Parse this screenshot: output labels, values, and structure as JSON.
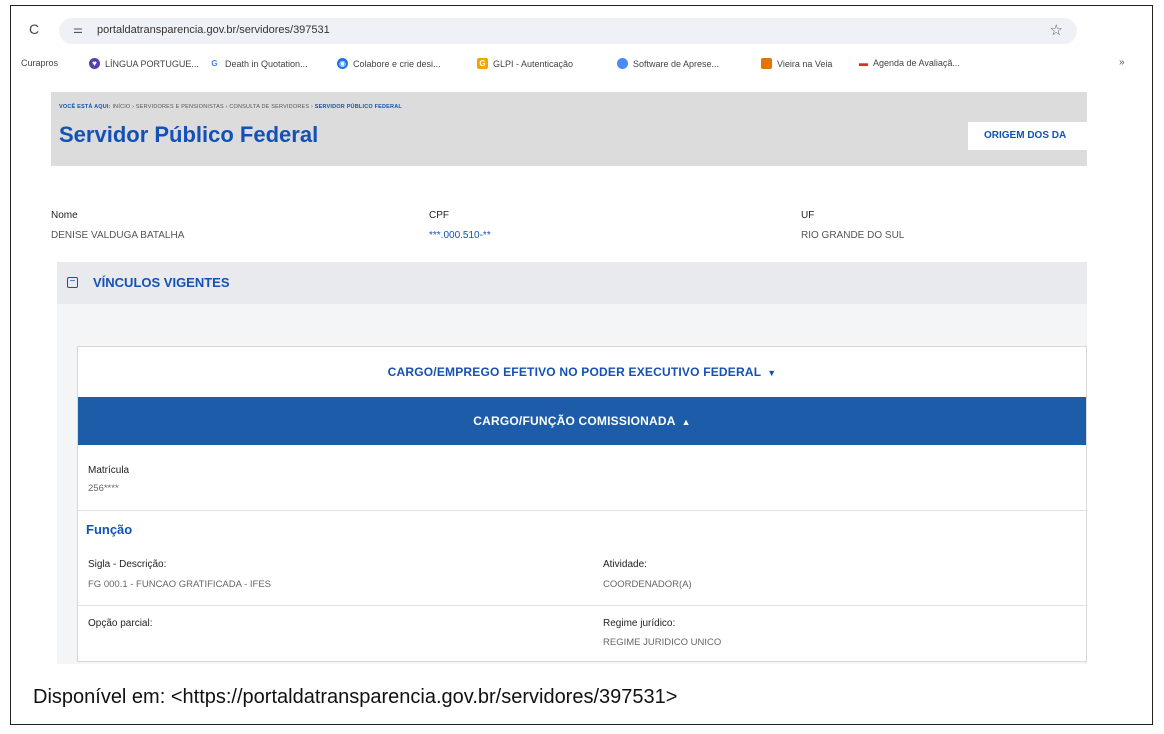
{
  "browser": {
    "url": "portaldatransparencia.gov.br/servidores/397531",
    "bookmarks": [
      {
        "label": "Curapros",
        "color": ""
      },
      {
        "label": "LÍNGUA PORTUGUE...",
        "color": "#5a3fa8"
      },
      {
        "label": "Death in Quotation...",
        "color": "#4285f4"
      },
      {
        "label": "Colabore e crie desi...",
        "color": "#1a73e8"
      },
      {
        "label": "GLPI - Autenticação",
        "color": "#f2a600"
      },
      {
        "label": "Software de Aprese...",
        "color": "#4a8af4"
      },
      {
        "label": "Vieira na Veia",
        "color": "#e37400"
      },
      {
        "label": "Agenda de Avaliaçã...",
        "color": "#d93025"
      }
    ],
    "more_label": "»"
  },
  "header": {
    "breadcrumb_prefix": "VOCÊ ESTÁ AQUI:",
    "breadcrumb_path": "INÍCIO › SERVIDORES E PENSIONISTAS › CONSULTA DE SERVIDORES ›",
    "breadcrumb_current": "SERVIDOR PÚBLICO FEDERAL",
    "title": "Servidor Público Federal",
    "origem_button": "ORIGEM DOS DA"
  },
  "person": {
    "nome_label": "Nome",
    "nome_value": "DENISE VALDUGA BATALHA",
    "cpf_label": "CPF",
    "cpf_value": "***.000.510-**",
    "uf_label": "UF",
    "uf_value": "RIO GRANDE DO SUL"
  },
  "vinculos": {
    "toggle_symbol": "−",
    "label": "VÍNCULOS VIGENTES",
    "tab_efetivo": "CARGO/EMPREGO EFETIVO NO PODER EXECUTIVO FEDERAL",
    "tab_efetivo_caret": "▼",
    "tab_comissionada": "CARGO/FUNÇÃO COMISSIONADA",
    "tab_comissionada_caret": "▲"
  },
  "detalhe": {
    "matricula_label": "Matrícula",
    "matricula_value": "256****",
    "funcao_title": "Função",
    "sigla_label": "Sigla - Descrição:",
    "sigla_value": "FG 000.1 - FUNCAO GRATIFICADA - IFES",
    "atividade_label": "Atividade:",
    "atividade_value": "COORDENADOR(A)",
    "opcao_label": "Opção parcial:",
    "regime_label": "Regime jurídico:",
    "regime_value": "REGIME JURIDICO UNICO"
  },
  "caption": "Disponível em: <https://portaldatransparencia.gov.br/servidores/397531>",
  "colors": {
    "brand_blue": "#1351b4",
    "active_tab": "#1d5ca8"
  }
}
